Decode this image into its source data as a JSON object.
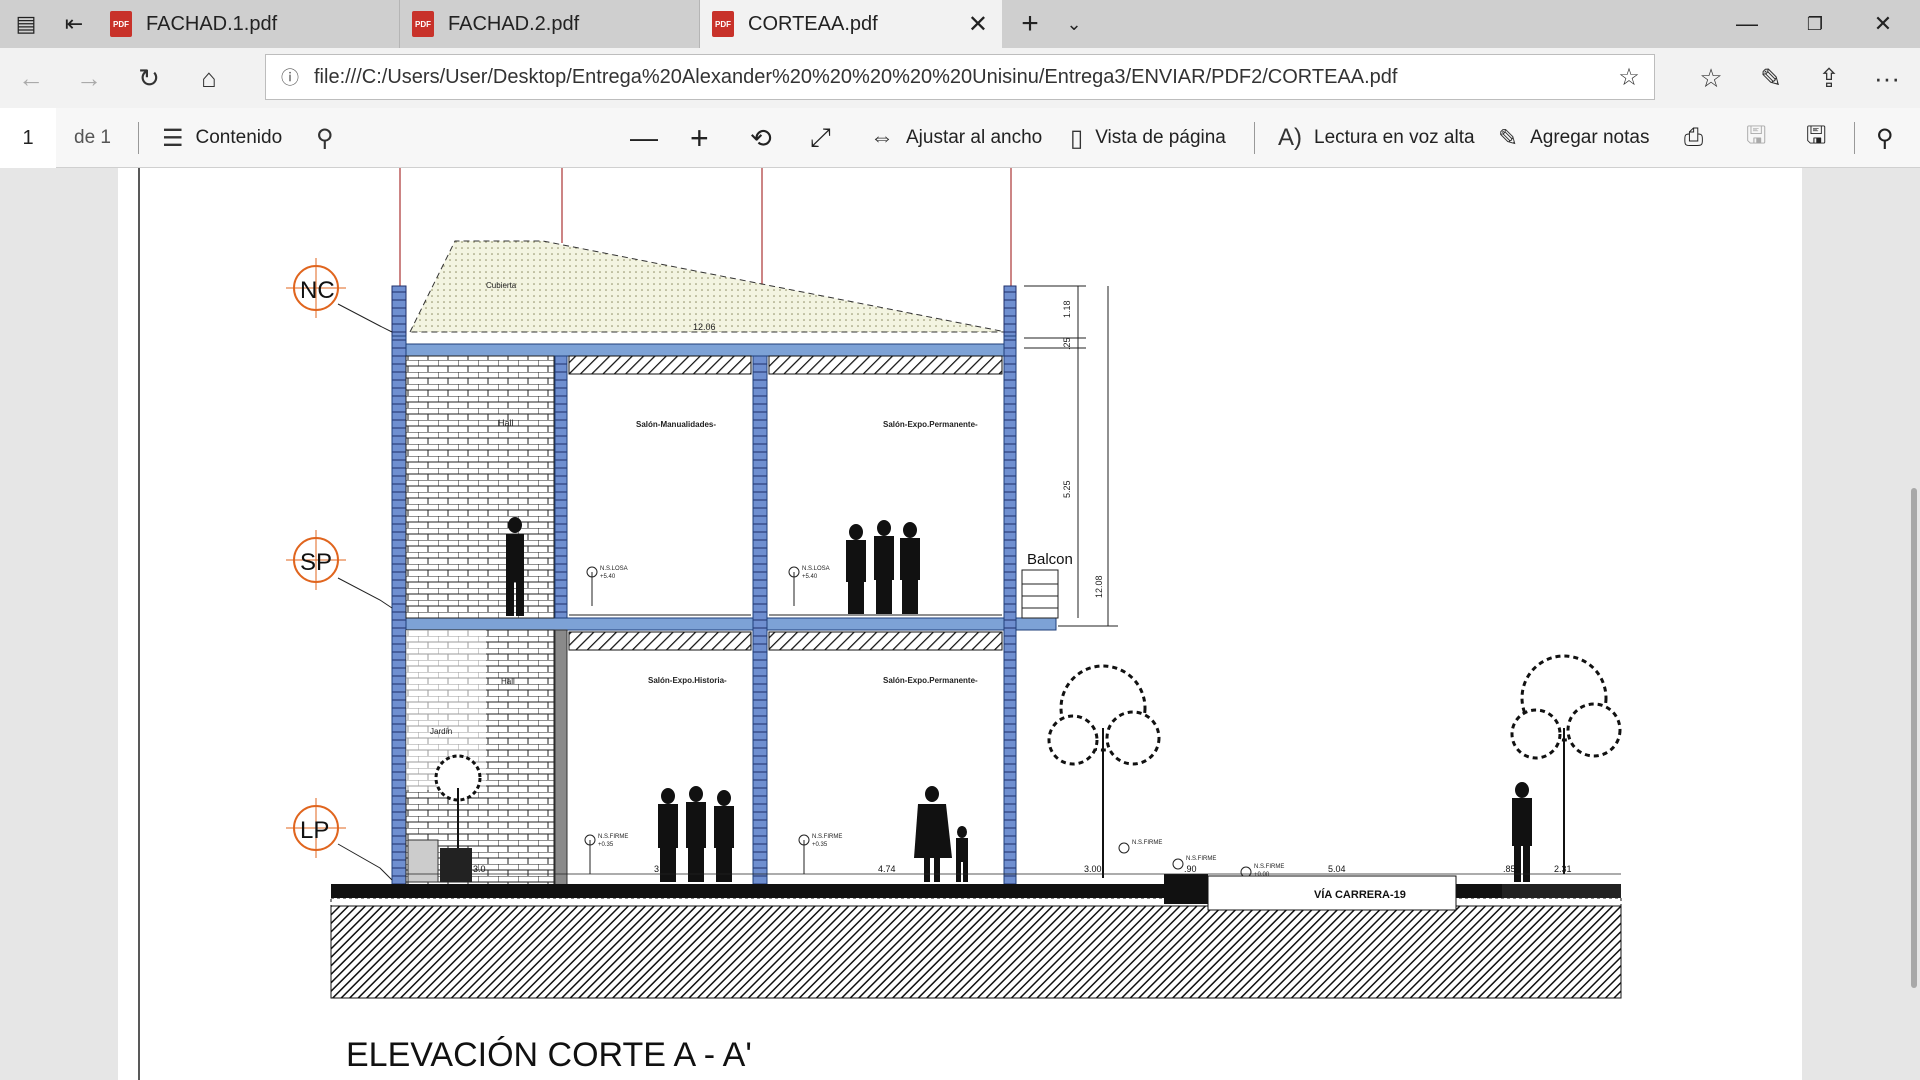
{
  "tabs": [
    {
      "label": "FACHAD.1.pdf"
    },
    {
      "label": "FACHAD.2.pdf"
    },
    {
      "label": "CORTEAA.pdf"
    }
  ],
  "address": {
    "url": "file:///C:/Users/User/Desktop/Entrega%20Alexander%20%20%20%20%20Unisinu/Entrega3/ENVIAR/PDF2/CORTEAA.pdf"
  },
  "pdf_toolbar": {
    "page_number": "1",
    "page_total": "de 1",
    "contents_label": "Contenido",
    "fit_width_label": "Ajustar al ancho",
    "page_view_label": "Vista de página",
    "read_aloud_label": "Lectura en voz alta",
    "add_notes_label": "Agregar notas"
  },
  "drawing": {
    "title": "ELEVACIÓN CORTE A - A'",
    "levels": [
      "NC",
      "SP",
      "LP"
    ],
    "labels": {
      "cubierta": "Cubierta",
      "hall_upper": "Hall",
      "hall_lower": "Hall",
      "jardin": "Jardín",
      "salon_manualidades": "Salón-Manualidades-",
      "salon_expo_permanente_upper": "Salón-Expo.Permanente-",
      "salon_expo_historia": "Salón-Expo.Historia-",
      "salon_expo_permanente_lower": "Salón-Expo.Permanente-",
      "balcon": "Balcon",
      "via": "VÍA CARRERA-19",
      "ns_losa": "N.S.LOSA",
      "ns_losa_val": "+5.40",
      "ns_firme": "N.S.FIRME",
      "ns_firme_val": "+0.35",
      "ns_firme_val2": "+0.00"
    },
    "dimensions": {
      "roof_width": "12.06",
      "d1": "1.18",
      "d2": ".25",
      "d3": "5.25",
      "d4": "12.08",
      "b1": "3.0",
      "b2": "3",
      "b3": "4.74",
      "b4": "3.00",
      "b5": ".90",
      "b6": "5.04",
      "b7": "2.31",
      "b8": ".85"
    }
  }
}
